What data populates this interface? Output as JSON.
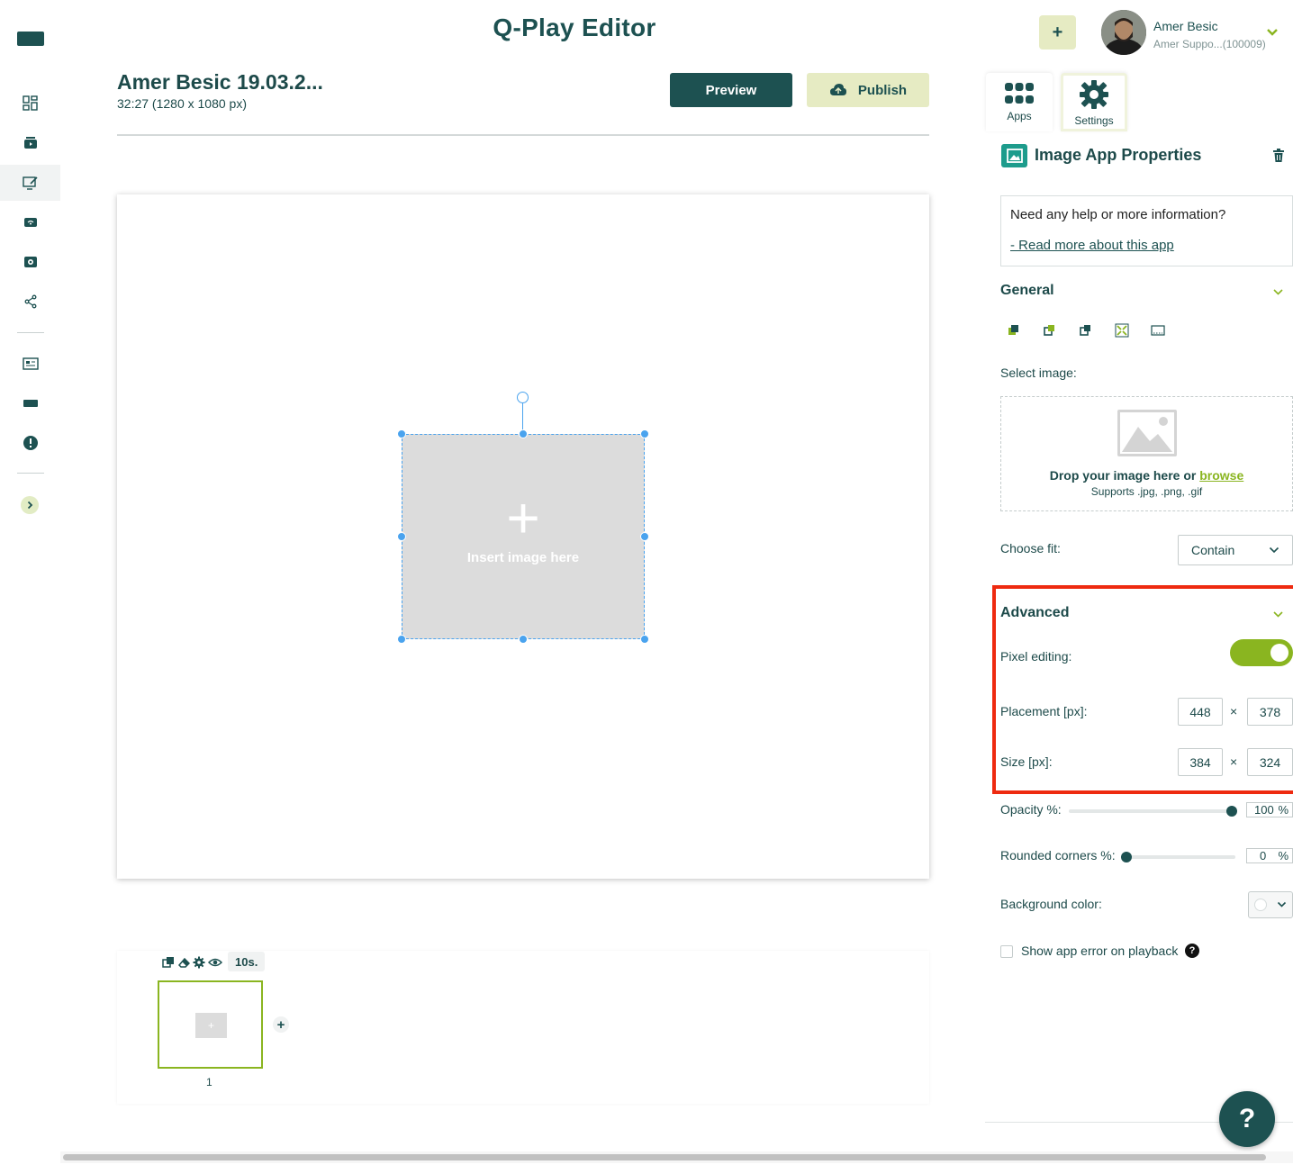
{
  "header": {
    "app_title": "Q-Play Editor",
    "add_label": "+",
    "user_name": "Amer Besic",
    "user_sub": "Amer Suppo...(100009)"
  },
  "document": {
    "title": "Amer Besic 19.03.2...",
    "subtitle": "32:27 (1280 x 1080 px)",
    "preview_label": "Preview",
    "publish_label": "Publish"
  },
  "canvas": {
    "placeholder_label": "Insert image here",
    "placeholder_plus": "+"
  },
  "timeline": {
    "duration": "10s.",
    "slide_number": "1",
    "slide_thumb_plus": "+",
    "add_label": "+"
  },
  "panel": {
    "tabs": [
      {
        "label": "Apps",
        "icon": "grid-icon"
      },
      {
        "label": "Settings",
        "icon": "gear-icon"
      }
    ],
    "title": "Image App Properties",
    "help_question": "Need any help or more information?",
    "help_link": "- Read more about this app",
    "general": {
      "title": "General",
      "select_image_label": "Select image:",
      "drop_text": "Drop your image here or ",
      "browse_label": "browse",
      "supports": "Supports .jpg, .png, .gif",
      "fit_label": "Choose fit:",
      "fit_value": "Contain"
    },
    "advanced": {
      "title": "Advanced",
      "pixel_editing_label": "Pixel editing:",
      "pixel_editing_on": true,
      "placement_label": "Placement [px]:",
      "placement_x": "448",
      "placement_y": "378",
      "size_label": "Size [px]:",
      "size_w": "384",
      "size_h": "324",
      "times": "×"
    },
    "opacity_label": "Opacity %:",
    "opacity_value": "100",
    "rounded_label": "Rounded corners %:",
    "rounded_value": "0",
    "percent": "%",
    "bg_color_label": "Background color:",
    "show_error_label": "Show app error on playback",
    "help_q": "?"
  },
  "fab": {
    "label": "?"
  },
  "colors": {
    "brand": "#1d5151",
    "accent": "#8ab520",
    "highlight": "#ee2a10",
    "selection": "#4aa3ee"
  }
}
